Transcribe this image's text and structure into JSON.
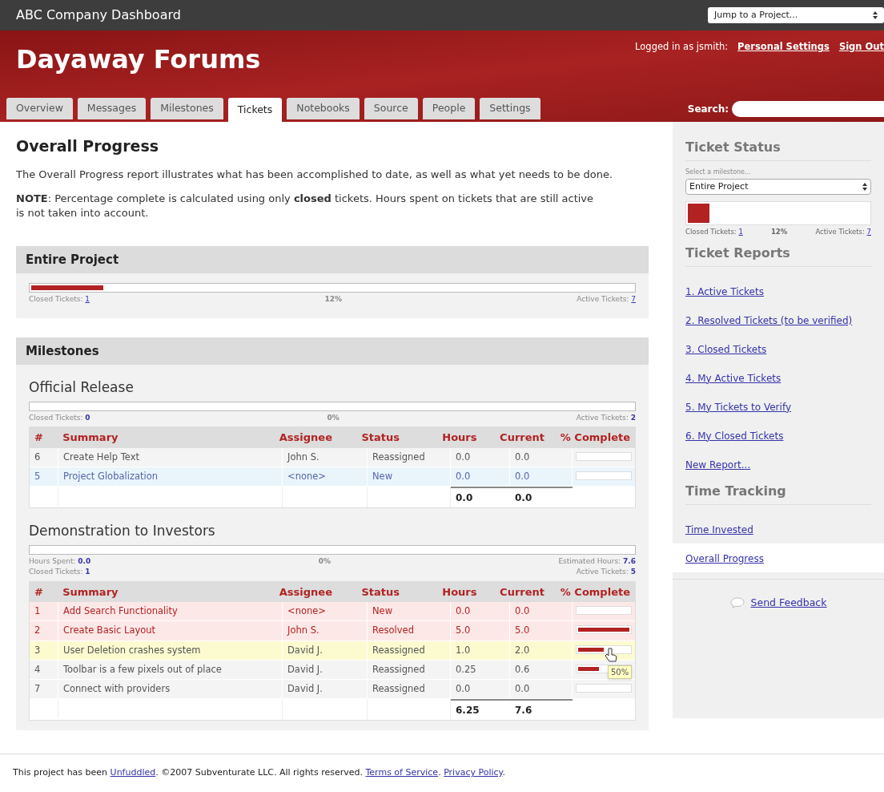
{
  "topbar": {
    "title": "ABC Company Dashboard",
    "jump_select": "Jump to a Project..."
  },
  "header": {
    "project": "Dayaway Forums",
    "logged_in": "Logged in as jsmith:",
    "links": [
      "Personal Settings",
      "Sign Out"
    ],
    "search_label": "Search:"
  },
  "tabs": [
    {
      "label": "Overview",
      "selected": false
    },
    {
      "label": "Messages",
      "selected": false
    },
    {
      "label": "Milestones",
      "selected": false
    },
    {
      "label": "Tickets",
      "selected": true
    },
    {
      "label": "Notebooks",
      "selected": false
    },
    {
      "label": "Source",
      "selected": false
    },
    {
      "label": "People",
      "selected": false
    },
    {
      "label": "Settings",
      "selected": false
    }
  ],
  "main": {
    "title": "Overall Progress",
    "intro": "The Overall Progress report illustrates what has been accomplished to date, as well as what yet needs to be done.",
    "note": "**NOTE**: Percentage complete is calculated using only **closed** tickets. Hours spent on tickets that are still active is not taken into account.",
    "entire_project": {
      "heading": "Entire Project",
      "level": 0.12,
      "percent": "12%",
      "left": [
        {
          "label": "Closed Tickets:",
          "value": "1",
          "link": true
        }
      ],
      "right": [
        {
          "label": "Active Tickets:",
          "value": "7",
          "link": true
        }
      ]
    },
    "milestones_heading": "Milestones",
    "milestones": [
      {
        "title": "Official Release",
        "columns": [
          "#",
          "Summary",
          "Assignee",
          "Status",
          "Hours",
          "Current",
          "% Complete"
        ],
        "percent": "0%",
        "left": [
          {
            "label": "Closed Tickets:",
            "value": "0",
            "link": false
          }
        ],
        "right": [
          {
            "label": "Active Tickets:",
            "value": "2",
            "link": false
          }
        ],
        "rows": [
          {
            "kind": "plain",
            "cells": [
              "6",
              "Create Help Text",
              "John S.",
              "Reassigned",
              "0.0",
              "0.0"
            ]
          },
          {
            "kind": "new",
            "cells": [
              "5",
              "Project Globalization",
              "<none>",
              "New",
              "0.0",
              "0.0"
            ]
          }
        ],
        "totals": [
          "0.0",
          "0.0"
        ]
      },
      {
        "title": "Demonstration to Investors",
        "columns": [
          "#",
          "Summary",
          "Assignee",
          "Status",
          "Hours",
          "Current",
          "% Complete"
        ],
        "percent": "0%",
        "left": [
          {
            "label": "Hours Spent:",
            "value": "0.0",
            "link": false
          },
          {
            "label": "Closed Tickets:",
            "value": "1",
            "link": false
          }
        ],
        "right": [
          {
            "label": "Estimated Hours:",
            "value": "7.6",
            "link": false
          },
          {
            "label": "Active Tickets:",
            "value": "5",
            "link": false
          }
        ],
        "rows": [
          {
            "kind": "urgent",
            "cells": [
              "1",
              "Add Search Functionality",
              "<none>",
              "New",
              "0.0",
              "0.0"
            ]
          },
          {
            "kind": "urgent",
            "cells": [
              "2",
              "Create Basic Layout",
              "John S.",
              "Resolved",
              "5.0",
              "5.0"
            ],
            "level": 1
          },
          {
            "kind": "hover",
            "cells": [
              "3",
              "User Deletion crashes system",
              "David J.",
              "Reassigned",
              "1.0",
              "2.0"
            ],
            "level": 0.5,
            "tooltip": "50%"
          },
          {
            "kind": "plain",
            "cells": [
              "4",
              "Toolbar is a few pixels out of place",
              "David J.",
              "Reassigned",
              "0.25",
              "0.6"
            ],
            "level": 0.4
          },
          {
            "kind": "plain",
            "cells": [
              "7",
              "Connect with providers",
              "David J.",
              "Reassigned",
              "0.0",
              "0.0"
            ]
          }
        ],
        "totals": [
          "6.25",
          "7.6"
        ]
      }
    ]
  },
  "sidebar": {
    "status_heading": "Ticket Status",
    "select_label": "Select a milestone...",
    "select_value": "Entire Project",
    "level": 0.12,
    "closed": "Closed Tickets:",
    "closed_value": "1",
    "percent": "12%",
    "active": "Active Tickets:",
    "active_value": "7",
    "reports_heading": "Ticket Reports",
    "reports": [
      {
        "label": "1. Active Tickets",
        "selected": false
      },
      {
        "label": "2. Resolved Tickets (to be verified)",
        "selected": false
      },
      {
        "label": "3. Closed Tickets",
        "selected": false
      },
      {
        "label": "4. My Active Tickets",
        "selected": false
      },
      {
        "label": "5. My Tickets to Verify",
        "selected": false
      },
      {
        "label": "6. My Closed Tickets",
        "selected": false
      },
      {
        "label": "New Report...",
        "selected": false
      }
    ],
    "time_heading": "Time Tracking",
    "time": [
      {
        "label": "Time Invested",
        "selected": false
      },
      {
        "label": "Overall Progress",
        "selected": true
      }
    ],
    "feedback": "Send Feedback"
  },
  "footer": {
    "parts": [
      {
        "text": "This project has been ",
        "link": false
      },
      {
        "text": "Unfuddled",
        "link": true
      },
      {
        "text": ". ©2007 Subventurate LLC. All rights reserved. ",
        "link": false
      },
      {
        "text": "Terms of Service",
        "link": true
      },
      {
        "text": ". ",
        "link": false
      },
      {
        "text": "Privacy Policy",
        "link": true
      },
      {
        "text": ".",
        "link": false
      }
    ]
  }
}
